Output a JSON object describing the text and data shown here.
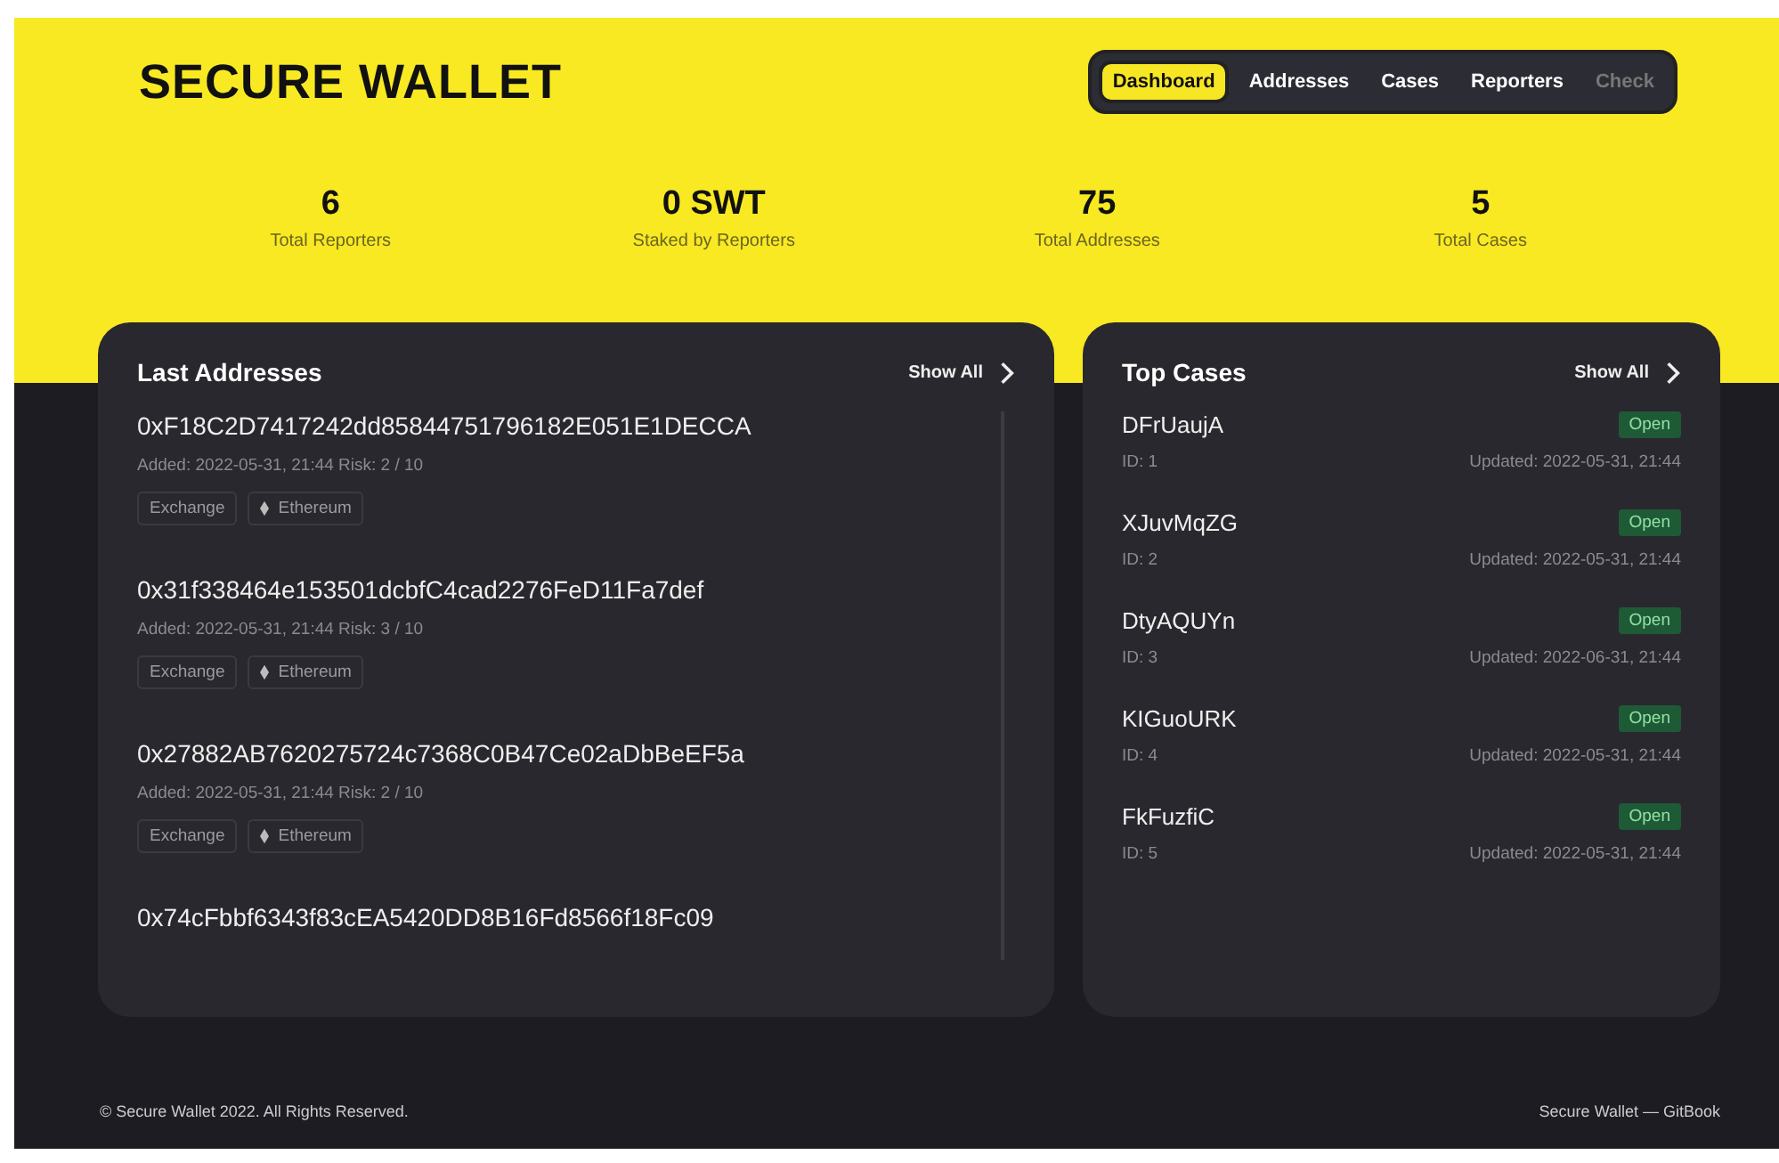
{
  "brand": {
    "title": "SECURE WALLET"
  },
  "nav": [
    {
      "label": "Dashboard",
      "selected": true,
      "disabled": false
    },
    {
      "label": "Addresses",
      "selected": false,
      "disabled": false
    },
    {
      "label": "Cases",
      "selected": false,
      "disabled": false
    },
    {
      "label": "Reporters",
      "selected": false,
      "disabled": false
    },
    {
      "label": "Check",
      "selected": false,
      "disabled": true
    }
  ],
  "stats": [
    {
      "value": "6",
      "label": "Total Reporters"
    },
    {
      "value": "0 SWT",
      "label": "Staked by Reporters"
    },
    {
      "value": "75",
      "label": "Total Addresses"
    },
    {
      "value": "5",
      "label": "Total Cases"
    }
  ],
  "last_addresses": {
    "title": "Last Addresses",
    "show_all": "Show All",
    "items": [
      {
        "address": "0xF18C2D7417242dd85844751796182E051E1DECCA",
        "meta": "Added: 2022-05-31, 21:44  Risk: 2 / 10",
        "tags": [
          {
            "kind": "plain",
            "label": "Exchange"
          },
          {
            "kind": "chain",
            "label": "Ethereum"
          }
        ]
      },
      {
        "address": "0x31f338464e153501dcbfC4cad2276FeD11Fa7def",
        "meta": "Added: 2022-05-31, 21:44  Risk: 3 / 10",
        "tags": [
          {
            "kind": "plain",
            "label": "Exchange"
          },
          {
            "kind": "chain",
            "label": "Ethereum"
          }
        ]
      },
      {
        "address": "0x27882AB7620275724c7368C0B47Ce02aDbBeEF5a",
        "meta": "Added: 2022-05-31, 21:44  Risk: 2 / 10",
        "tags": [
          {
            "kind": "plain",
            "label": "Exchange"
          },
          {
            "kind": "chain",
            "label": "Ethereum"
          }
        ]
      },
      {
        "address": "0x74cFbbf6343f83cEA5420DD8B16Fd8566f18Fc09"
      }
    ]
  },
  "top_cases": {
    "title": "Top Cases",
    "show_all": "Show All",
    "items": [
      {
        "name": "DFrUaujA",
        "id": "ID: 1",
        "status": "Open",
        "updated": "Updated: 2022-05-31, 21:44"
      },
      {
        "name": "XJuvMqZG",
        "id": "ID: 2",
        "status": "Open",
        "updated": "Updated: 2022-05-31, 21:44"
      },
      {
        "name": "DtyAQUYn",
        "id": "ID: 3",
        "status": "Open",
        "updated": "Updated: 2022-06-31, 21:44"
      },
      {
        "name": "KIGuoURK",
        "id": "ID: 4",
        "status": "Open",
        "updated": "Updated: 2022-05-31, 21:44"
      },
      {
        "name": "FkFuzfiC",
        "id": "ID: 5",
        "status": "Open",
        "updated": "Updated: 2022-05-31, 21:44"
      }
    ]
  },
  "footer": {
    "copyright": "© Secure Wallet 2022. All Rights Reserved.",
    "link": "Secure Wallet — GitBook"
  }
}
